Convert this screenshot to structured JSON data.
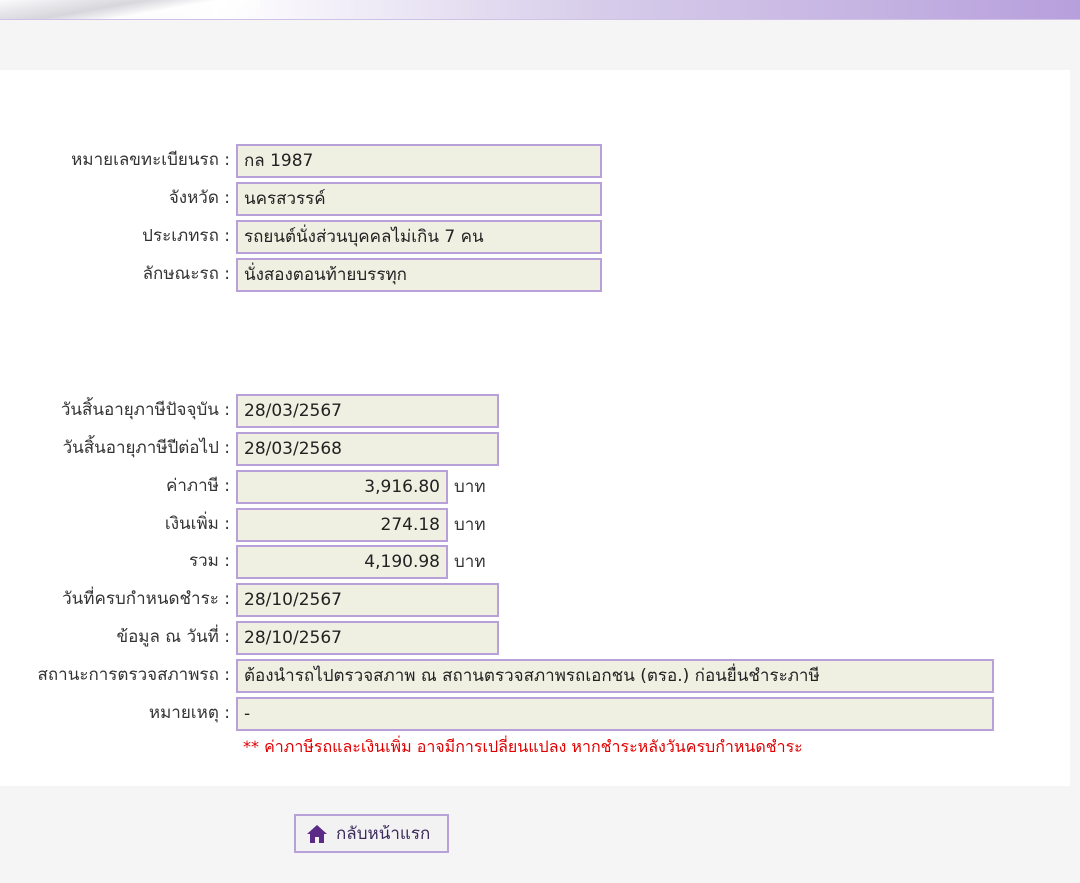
{
  "vehicle": {
    "plate_label": "หมายเลขทะเบียนรถ :",
    "plate_value": "กล 1987",
    "province_label": "จังหวัด :",
    "province_value": "นครสวรรค์",
    "type_label": "ประเภทรถ :",
    "type_value": "รถยนต์นั่งส่วนบุคคลไม่เกิน 7 คน",
    "body_label": "ลักษณะรถ :",
    "body_value": "นั่งสองตอนท้ายบรรทุก"
  },
  "tax": {
    "current_expiry_label": "วันสิ้นอายุภาษีปัจจุบัน :",
    "current_expiry_value": "28/03/2567",
    "next_expiry_label": "วันสิ้นอายุภาษีปีต่อไป :",
    "next_expiry_value": "28/03/2568",
    "tax_label": "ค่าภาษี :",
    "tax_value": "3,916.80",
    "surcharge_label": "เงินเพิ่ม :",
    "surcharge_value": "274.18",
    "total_label": "รวม :",
    "total_value": "4,190.98",
    "unit": "บาท",
    "due_label": "วันที่ครบกำหนดชำระ :",
    "due_value": "28/10/2567",
    "asof_label": "ข้อมูล ณ วันที่ :",
    "asof_value": "28/10/2567",
    "inspection_label": "สถานะการตรวจสภาพรถ :",
    "inspection_value": "ต้องนำรถไปตรวจสภาพ ณ สถานตรวจสภาพรถเอกชน (ตรอ.) ก่อนยื่นชำระภาษี",
    "remark_label": "หมายเหตุ :",
    "remark_value": "-"
  },
  "note": "** ค่าภาษีรถและเงินเพิ่ม อาจมีการเปลี่ยนแปลง หากชำระหลังวันครบกำหนดชำระ",
  "home_button": {
    "label": "กลับหน้าแรก",
    "icon": "home-icon"
  },
  "colors": {
    "field_border": "#b7a1d8",
    "field_bg": "#efefe2",
    "note_red": "#e00000",
    "icon_purple": "#5b2a86"
  }
}
